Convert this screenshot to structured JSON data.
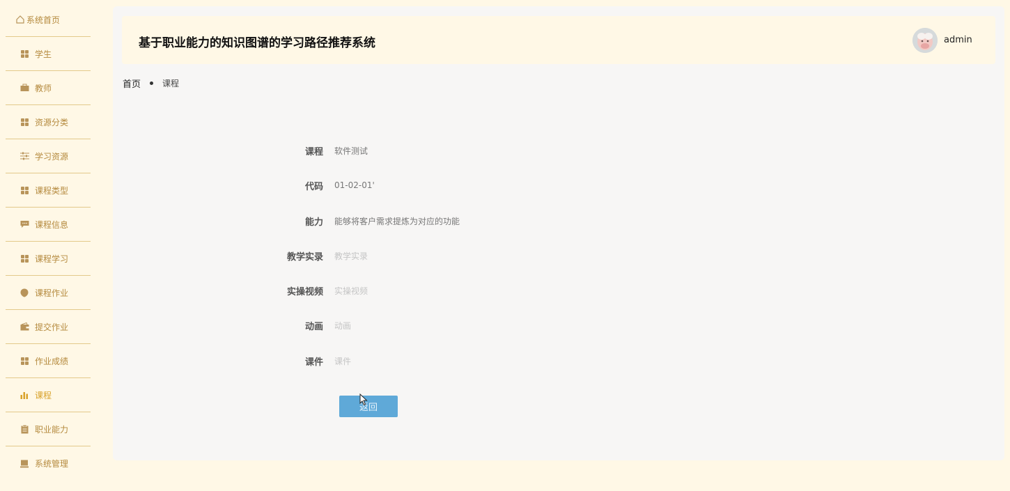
{
  "sidebar": {
    "items": [
      {
        "label": "系统首页",
        "icon": "home-icon"
      },
      {
        "label": "学生",
        "icon": "grid-icon"
      },
      {
        "label": "教师",
        "icon": "briefcase-icon"
      },
      {
        "label": "资源分类",
        "icon": "grid-icon"
      },
      {
        "label": "学习资源",
        "icon": "sliders-icon"
      },
      {
        "label": "课程类型",
        "icon": "grid-icon"
      },
      {
        "label": "课程信息",
        "icon": "message-icon"
      },
      {
        "label": "课程学习",
        "icon": "grid-icon"
      },
      {
        "label": "课程作业",
        "icon": "shield-icon"
      },
      {
        "label": "提交作业",
        "icon": "wallet-icon"
      },
      {
        "label": "作业成绩",
        "icon": "grid-icon"
      },
      {
        "label": "课程",
        "icon": "bar-chart-icon",
        "active": true
      },
      {
        "label": "职业能力",
        "icon": "clipboard-icon"
      },
      {
        "label": "系统管理",
        "icon": "monitor-icon"
      }
    ]
  },
  "header": {
    "title": "基于职业能力的知识图谱的学习路径推荐系统",
    "username": "admin"
  },
  "breadcrumb": {
    "home": "首页",
    "current": "课程"
  },
  "form": {
    "rows": [
      {
        "label": "课程",
        "value": "软件测试",
        "placeholder": false
      },
      {
        "label": "代码",
        "value": "01-02-01'",
        "placeholder": false
      },
      {
        "label": "能力",
        "value": "能够将客户需求提炼为对应的功能",
        "placeholder": false
      },
      {
        "label": "教学实录",
        "value": "教学实录",
        "placeholder": true
      },
      {
        "label": "实操视频",
        "value": "实操视频",
        "placeholder": true
      },
      {
        "label": "动画",
        "value": "动画",
        "placeholder": true
      },
      {
        "label": "课件",
        "value": "课件",
        "placeholder": true
      }
    ],
    "back_label": "返回"
  },
  "colors": {
    "sidebar_bg": "#fff8e6",
    "accent": "#d8a22a",
    "button": "#5fa9d8"
  }
}
